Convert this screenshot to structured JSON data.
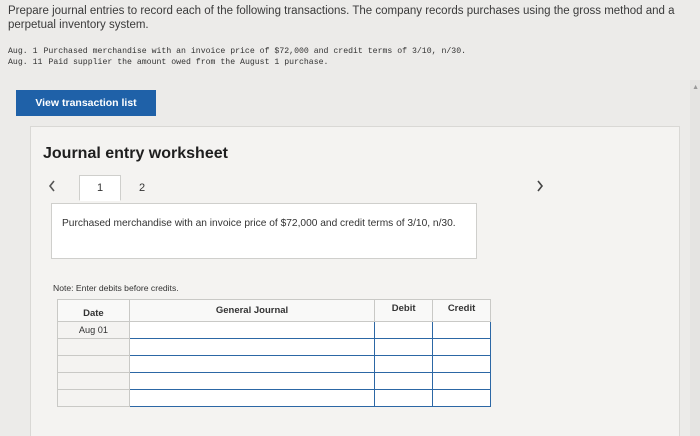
{
  "instructions": "Prepare journal entries to record each of the following transactions. The company records purchases using the gross method and a perpetual inventory system.",
  "transactions": [
    {
      "date": "Aug.  1",
      "text": "Purchased merchandise with an invoice price of $72,000 and credit terms of 3/10, n/30."
    },
    {
      "date": "Aug. 11",
      "text": "Paid supplier the amount owed from the August 1 purchase."
    }
  ],
  "view_button_label": "View transaction list",
  "worksheet": {
    "title": "Journal entry worksheet",
    "prev_icon": "chevron-left-icon",
    "next_icon": "chevron-right-icon",
    "tabs": [
      "1",
      "2"
    ],
    "description": "Purchased merchandise with an invoice price of $72,000 and credit terms of 3/10, n/30.",
    "note": "Note: Enter debits before credits.",
    "table": {
      "headers": [
        "Date",
        "General Journal",
        "Debit",
        "Credit"
      ],
      "first_date": "Aug 01"
    }
  }
}
